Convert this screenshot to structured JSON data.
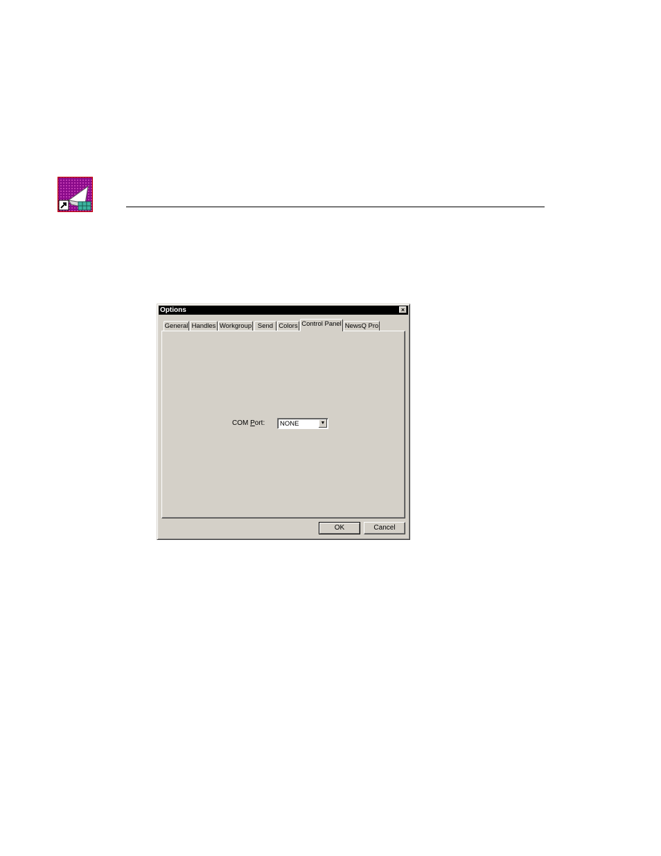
{
  "dialog": {
    "title": "Options",
    "close_label": "×",
    "tabs": [
      {
        "label": "General"
      },
      {
        "label": "Handles"
      },
      {
        "label": "Workgroup"
      },
      {
        "label": "Send"
      },
      {
        "label": "Colors"
      },
      {
        "label": "Control Panel",
        "active": true
      },
      {
        "label": "NewsQ Pro"
      }
    ],
    "com_port": {
      "label_prefix": "COM ",
      "label_access": "P",
      "label_suffix": "ort:",
      "value": "NONE"
    },
    "buttons": {
      "ok": "OK",
      "cancel": "Cancel"
    }
  },
  "icons": {
    "app": "app-shortcut-icon",
    "dropdown": "chevron-down-icon",
    "close": "close-icon"
  }
}
